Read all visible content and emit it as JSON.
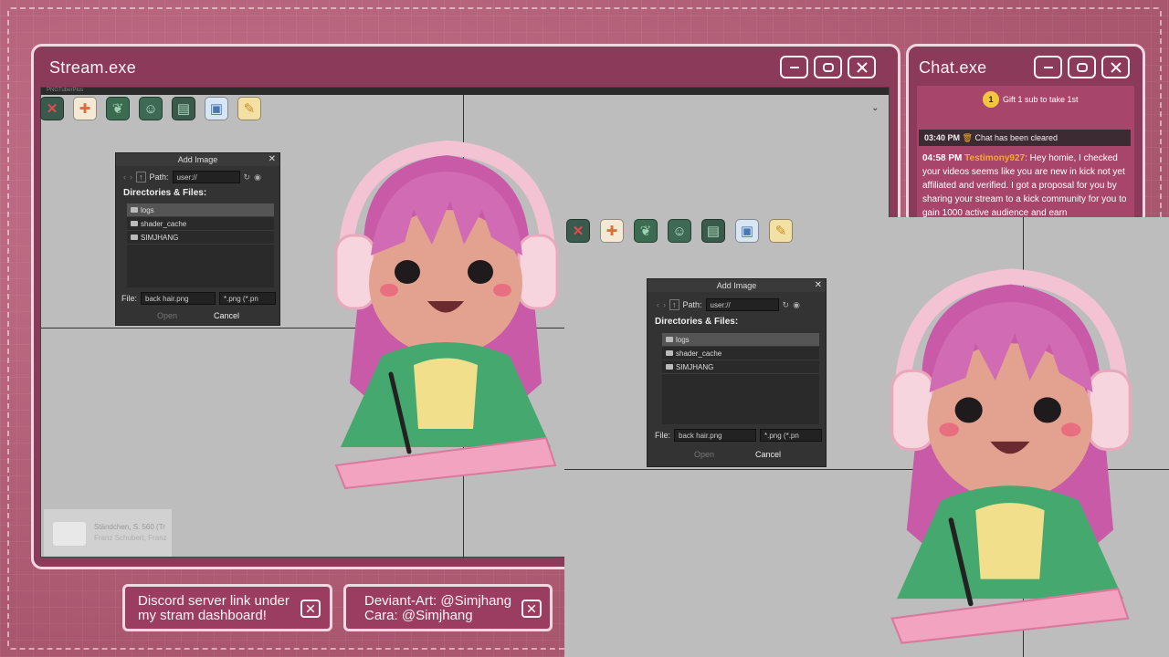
{
  "stream_window": {
    "title": "Stream.exe",
    "app_bar": "PNGTuberPlus",
    "buttons": [
      "minimize",
      "maximize",
      "close"
    ]
  },
  "chat_window": {
    "title": "Chat.exe",
    "gift_badge": "1",
    "gift_text": "Gift 1 sub to take 1st",
    "cleared_time": "03:40 PM",
    "cleared_text": "Chat has been cleared",
    "message_time": "04:58 PM",
    "message_user": "Testimony927",
    "message_text": "Hey homie, I checked your videos seems like you are new in kick not yet affiliated and verified. I got a proposal for you by sharing your stream to a kick community for you to gain 1000 active audience and earn"
  },
  "toolbar_icons": [
    "delete-icon",
    "add-image-icon",
    "leaf-icon",
    "face-icon",
    "document-icon",
    "save-icon",
    "settings-icon"
  ],
  "dialog": {
    "title": "Add Image",
    "path_label": "Path:",
    "path_value": "user://",
    "dirs_label": "Directories & Files:",
    "items": [
      "logs",
      "shader_cache",
      "SIMJHANG"
    ],
    "file_label": "File:",
    "file_value": "back hair.png",
    "filter_value": "*.png (*.pn",
    "open_label": "Open",
    "cancel_label": "Cancel"
  },
  "mini_player": {
    "track": "Ständchen, S. 560 (Tr",
    "artist": "Franz Schubert, Franz Li"
  },
  "notices": [
    {
      "line1": "Discord server link under",
      "line2": "my stram dashboard!"
    },
    {
      "line1": "Deviant-Art: @Simjhang",
      "line2": "Cara: @Simjhang"
    }
  ],
  "colors": {
    "background": "#b8647e",
    "window": "#8b3a5a",
    "border": "#f2d8e0",
    "username": "#f6a92d"
  }
}
